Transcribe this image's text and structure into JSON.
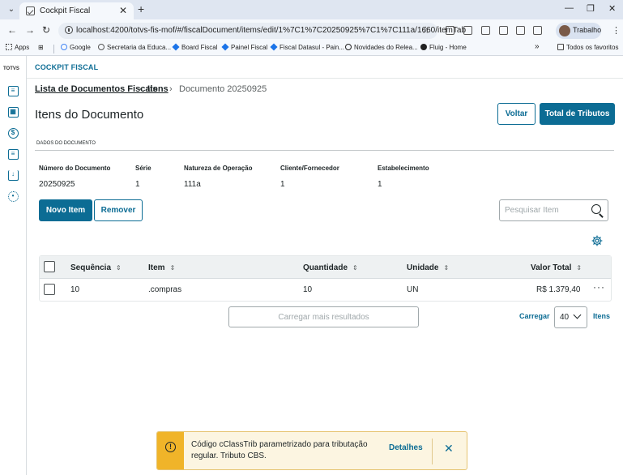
{
  "browser": {
    "tab_title": "Cockpit Fiscal",
    "url": "localhost:4200/totvs-fis-mof/#/fiscalDocument/items/edit/1%7C1%7C20250925%7C1%7C111a/1660/itemTab",
    "profile_label": "Trabalho",
    "bookmarks": [
      {
        "label": "Apps"
      },
      {
        "label": "Google"
      },
      {
        "label": "Secretaria da Educa..."
      },
      {
        "label": "Board Fiscal"
      },
      {
        "label": "Painel Fiscal"
      },
      {
        "label": "Fiscal Datasul - Pain..."
      },
      {
        "label": "Novidades do Relea..."
      },
      {
        "label": "Fluig - Home"
      }
    ],
    "bookmarks_more": "»",
    "all_bookmarks": "Todos os favoritos"
  },
  "app": {
    "logo_text": "TOTVS",
    "title": "COCKPIT FISCAL"
  },
  "breadcrumb": {
    "items": [
      {
        "label": "Lista de Documentos Fiscais"
      },
      {
        "label": "Itens"
      },
      {
        "label": "Documento 20250925"
      }
    ]
  },
  "page": {
    "title": "Itens do Documento",
    "back_button": "Voltar",
    "totals_button": "Total de Tributos"
  },
  "document": {
    "section_label": "DADOS DO DOCUMENTO",
    "fields": [
      {
        "label": "Número do Documento",
        "value": "20250925"
      },
      {
        "label": "Série",
        "value": "1"
      },
      {
        "label": "Natureza de Operação",
        "value": "111a"
      },
      {
        "label": "Cliente/Fornecedor",
        "value": "1"
      },
      {
        "label": "Estabelecimento",
        "value": "1"
      }
    ]
  },
  "actions": {
    "new_item": "Novo Item",
    "remove": "Remover",
    "search_placeholder": "Pesquisar Item"
  },
  "table": {
    "columns": [
      {
        "label": "Sequência"
      },
      {
        "label": "Item"
      },
      {
        "label": "Quantidade"
      },
      {
        "label": "Unidade"
      },
      {
        "label": "Valor Total"
      }
    ],
    "rows": [
      {
        "sequencia": "10",
        "item": ".compras",
        "quantidade": "10",
        "unidade": "UN",
        "valor_total": "R$ 1.379,40"
      }
    ]
  },
  "pagination": {
    "load_more": "Carregar mais resultados",
    "load_label": "Carregar",
    "page_size": "40",
    "items_label": "Itens"
  },
  "toast": {
    "message": "Código cClassTrib parametrizado para tributação regular. Tributo CBS.",
    "action": "Detalhes"
  },
  "colors": {
    "primary": "#0c6c94",
    "warning": "#f0b429",
    "toast_bg": "#fcf5e1"
  }
}
